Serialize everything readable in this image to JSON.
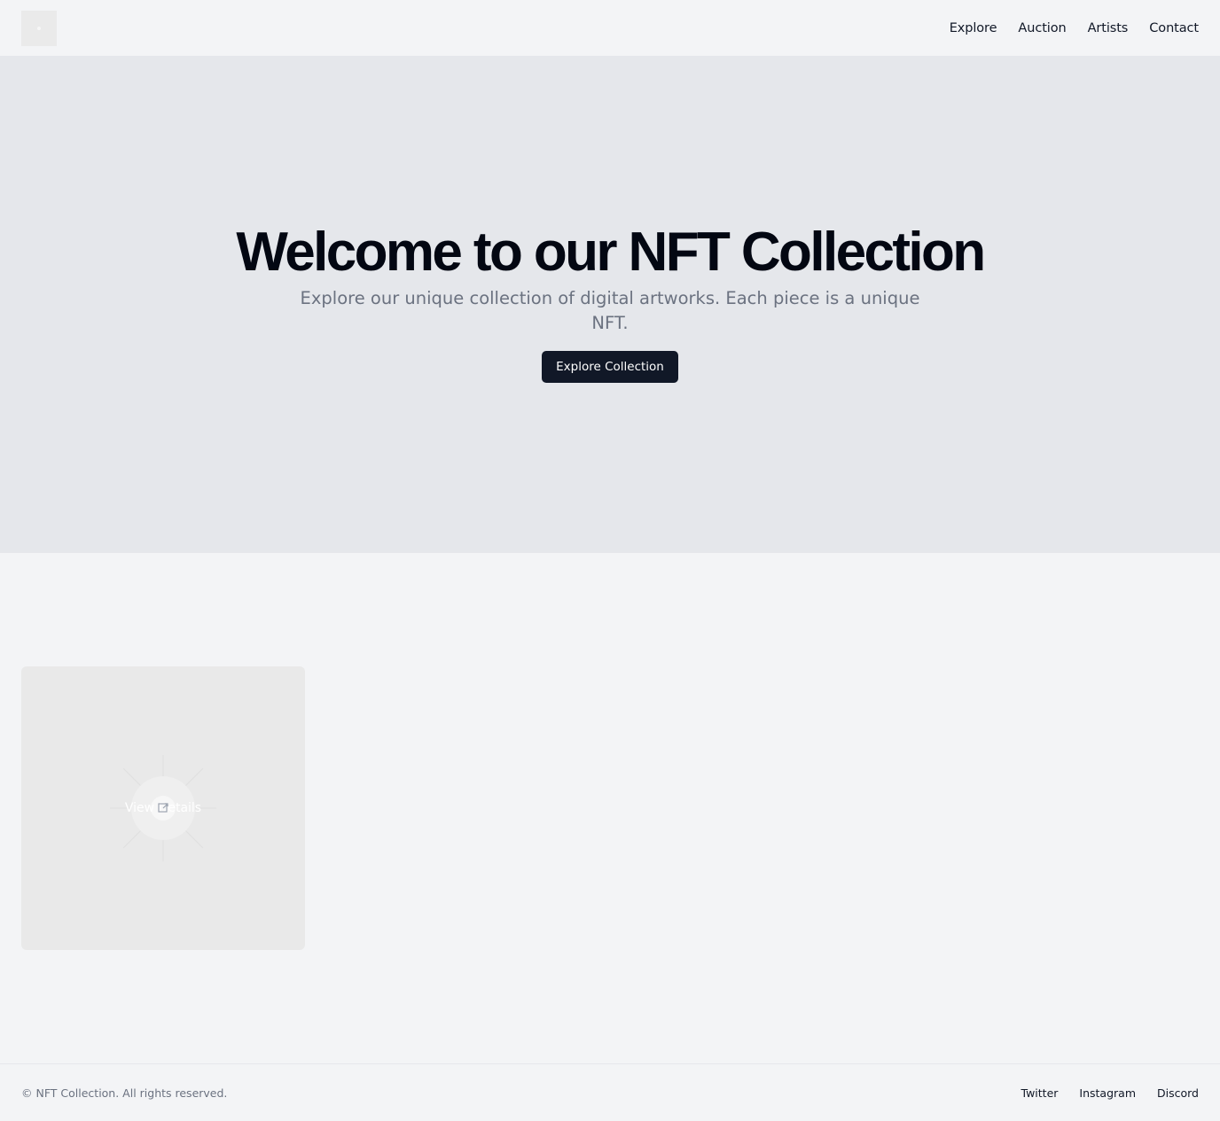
{
  "header": {
    "logo_icon": "logo-placeholder-icon",
    "nav": [
      {
        "label": "Explore"
      },
      {
        "label": "Auction"
      },
      {
        "label": "Artists"
      },
      {
        "label": "Contact"
      }
    ]
  },
  "hero": {
    "title": "Welcome to our NFT Collection",
    "subtitle": "Explore our unique collection of digital artworks. Each piece is a unique NFT.",
    "cta_label": "Explore Collection"
  },
  "gallery": {
    "items": [
      {
        "overlay_label": "View Details",
        "icon": "external-link-icon"
      }
    ]
  },
  "footer": {
    "copyright": "© NFT Collection. All rights reserved.",
    "links": [
      {
        "label": "Twitter"
      },
      {
        "label": "Instagram"
      },
      {
        "label": "Discord"
      }
    ]
  },
  "colors": {
    "page_bg": "#f3f4f6",
    "hero_bg": "#e5e7eb",
    "button_bg": "#111827",
    "muted_text": "#6b7280"
  }
}
